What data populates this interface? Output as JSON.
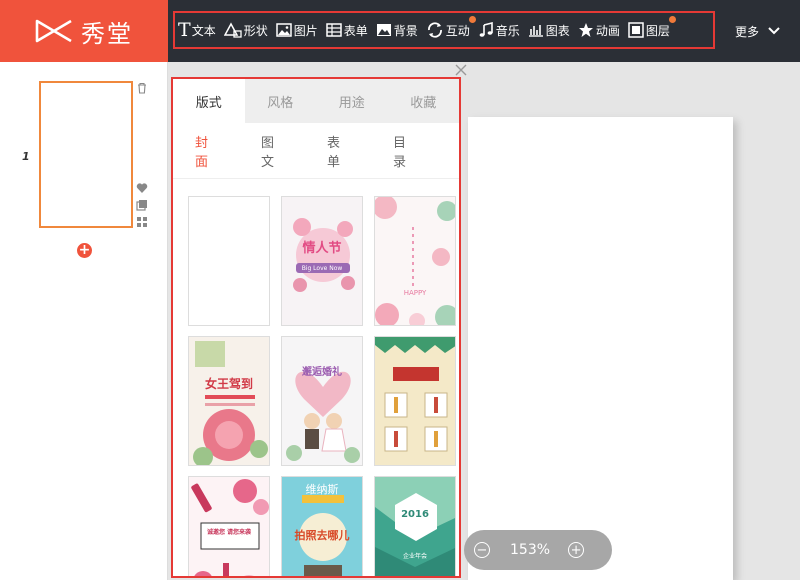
{
  "brand": {
    "name": "秀堂",
    "accent": "#f0533c"
  },
  "toolbar": {
    "items": [
      {
        "label": "文本",
        "icon": "text-icon"
      },
      {
        "label": "形状",
        "icon": "shape-icon"
      },
      {
        "label": "图片",
        "icon": "image-icon"
      },
      {
        "label": "表单",
        "icon": "form-icon"
      },
      {
        "label": "背景",
        "icon": "background-icon"
      },
      {
        "label": "互动",
        "icon": "interaction-icon",
        "badge": true
      },
      {
        "label": "音乐",
        "icon": "music-icon"
      },
      {
        "label": "图表",
        "icon": "chart-icon"
      },
      {
        "label": "动画",
        "icon": "animation-star-icon"
      },
      {
        "label": "图层",
        "icon": "layer-icon",
        "badge": true
      }
    ],
    "more_label": "更多"
  },
  "pages": {
    "current": "1"
  },
  "panel": {
    "tabs": [
      "版式",
      "风格",
      "用途",
      "收藏"
    ],
    "active_tab": "版式",
    "subtabs": [
      "封面",
      "图文",
      "表单",
      "目录"
    ],
    "active_subtab": "封面",
    "templates": [
      {
        "title": "",
        "style": "blank"
      },
      {
        "title": "情人节",
        "subtitle": "Big Love Now",
        "style": "valentine"
      },
      {
        "title": "HAPPY",
        "style": "floral-pink"
      },
      {
        "title": "女王驾到",
        "style": "queen"
      },
      {
        "title": "邂逅婚礼",
        "style": "wedding"
      },
      {
        "title": "",
        "style": "vintage-shop"
      },
      {
        "title": "诚邀您 请您来袭",
        "style": "lipstick"
      },
      {
        "title": "维纳斯",
        "subtitle": "拍照去哪儿",
        "style": "photo"
      },
      {
        "title": "2016",
        "subtitle": "企业年会",
        "style": "geometric"
      }
    ]
  },
  "zoom": {
    "value": "153%"
  }
}
